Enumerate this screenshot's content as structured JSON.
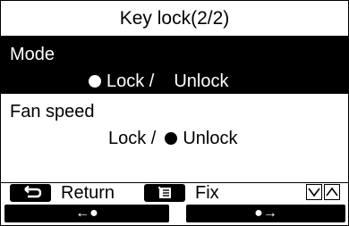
{
  "header": {
    "title": "Key lock(2/2)"
  },
  "settings": [
    {
      "label": "Mode",
      "lock": "Lock /",
      "unlock": "Unlock",
      "value": "lock",
      "selected": true
    },
    {
      "label": "Fan speed",
      "lock": "Lock /",
      "unlock": "Unlock",
      "value": "unlock",
      "selected": false
    }
  ],
  "footer": {
    "return_label": "Return",
    "fix_label": "Fix",
    "left_button": "←●",
    "right_button": "●→"
  },
  "icons": [
    "return-icon",
    "menu-icon",
    "chevron-down-icon",
    "chevron-up-icon",
    "radio-dot-icon"
  ]
}
